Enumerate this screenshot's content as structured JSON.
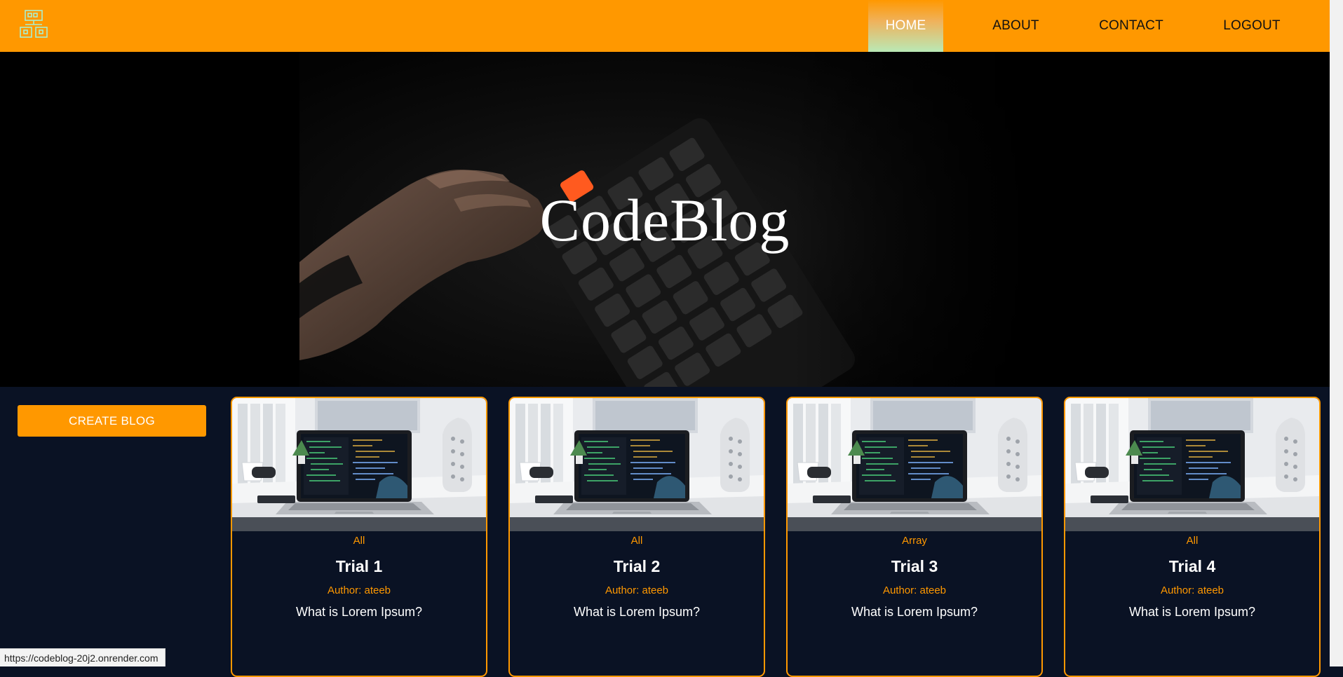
{
  "nav": {
    "items": [
      {
        "label": "HOME",
        "active": true
      },
      {
        "label": "ABOUT",
        "active": false
      },
      {
        "label": "CONTACT",
        "active": false
      },
      {
        "label": "LOGOUT",
        "active": false
      }
    ]
  },
  "hero": {
    "title": "CodeBlog"
  },
  "sidebar": {
    "create_label": "CREATE BLOG"
  },
  "cards": [
    {
      "category": "All",
      "title": "Trial 1",
      "author": "Author: ateeb",
      "description": "What is Lorem Ipsum?"
    },
    {
      "category": "All",
      "title": "Trial 2",
      "author": "Author: ateeb",
      "description": "What is Lorem Ipsum?"
    },
    {
      "category": "Array",
      "title": "Trial 3",
      "author": "Author: ateeb",
      "description": "What is Lorem Ipsum?"
    },
    {
      "category": "All",
      "title": "Trial 4",
      "author": "Author: ateeb",
      "description": "What is Lorem Ipsum?"
    }
  ],
  "status_bar": {
    "url": "https://codeblog-20j2.onrender.com"
  },
  "colors": {
    "accent": "#ff9800",
    "background": "#0a1224",
    "hero_bg": "#000000"
  }
}
